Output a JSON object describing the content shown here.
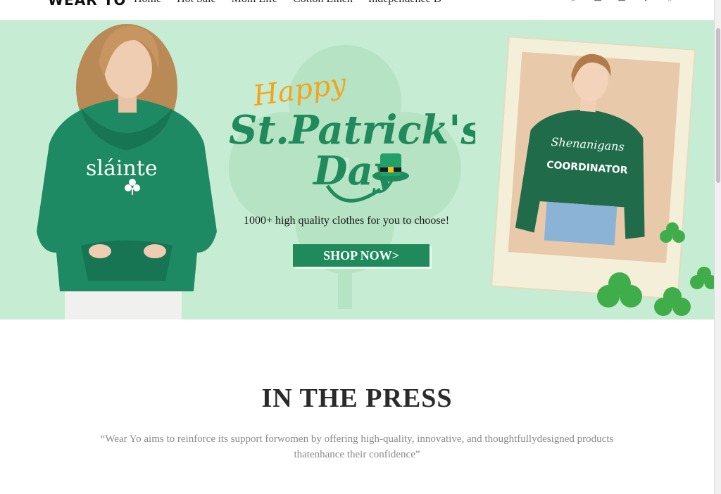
{
  "header": {
    "logo": "WEAR YO",
    "nav": [
      "Home",
      "Hot Sale",
      "Mom Life",
      "Cotton Linen",
      "Independence D"
    ],
    "icons": [
      "search-icon",
      "account-icon",
      "bag-icon",
      "heart-icon",
      "globe-icon"
    ]
  },
  "hero": {
    "happy": "Happy",
    "title_line1": "St.Patrick's",
    "title_line2": "Day",
    "tagline": "1000+ high quality clothes for you to choose!",
    "cta": "SHOP NOW>",
    "hoodie_text": "sláinte",
    "sweatshirt_text_1": "Shenanigans",
    "sweatshirt_text_2": "COORDINATOR",
    "colors": {
      "background": "#c6ecd3",
      "green": "#1f8a5b",
      "orange": "#f2a51a"
    }
  },
  "press": {
    "title": "IN THE PRESS",
    "quote": "“Wear Yo aims to reinforce its support forwomen by offering high-quality, innovative, and thoughtfullydesigned products thatenhance their confidence”"
  }
}
